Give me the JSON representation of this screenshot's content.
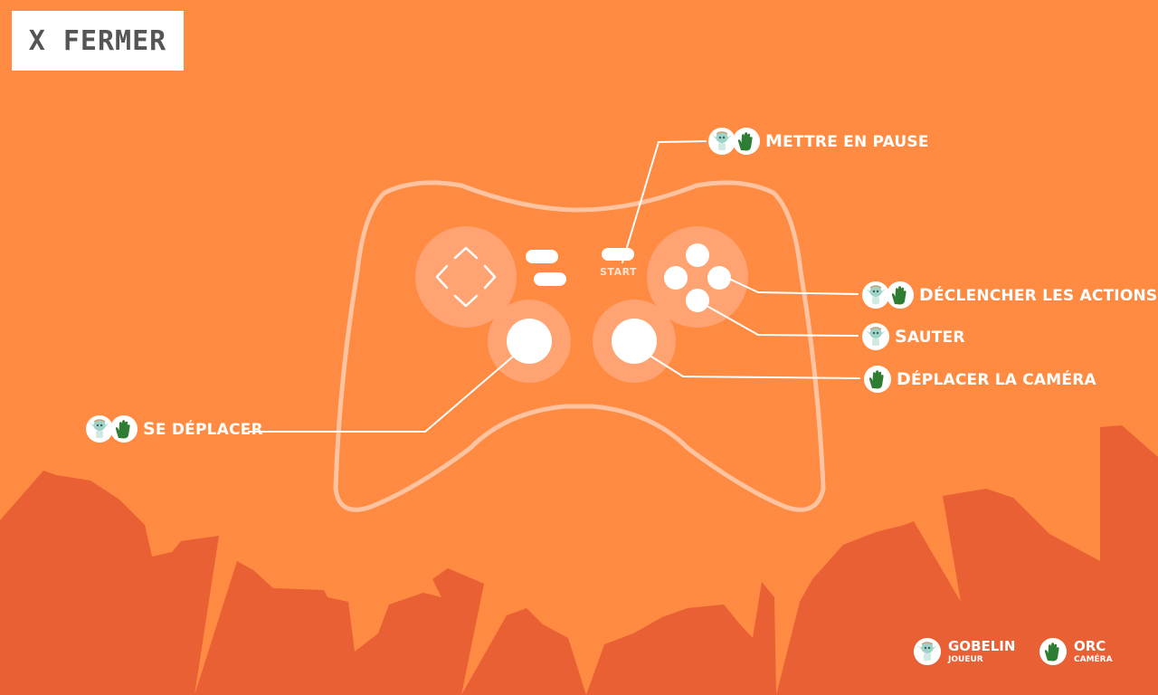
{
  "close_button": {
    "label": "X FERMER"
  },
  "controller": {
    "start_label": "START"
  },
  "controls": {
    "pause": "Mettre en pause",
    "actions": "Déclencher les actions",
    "jump": "Sauter",
    "camera": "Déplacer la caméra",
    "move": "Se déplacer"
  },
  "legend": [
    {
      "name": "Gobelin",
      "role": "JOUEUR",
      "icon": "goblin-icon"
    },
    {
      "name": "Orc",
      "role": "CAMÉRA",
      "icon": "orc-hand-icon"
    }
  ],
  "colors": {
    "background": "#ff8a42",
    "silhouette": "#e86034",
    "orc_green": "#2e7d32"
  }
}
